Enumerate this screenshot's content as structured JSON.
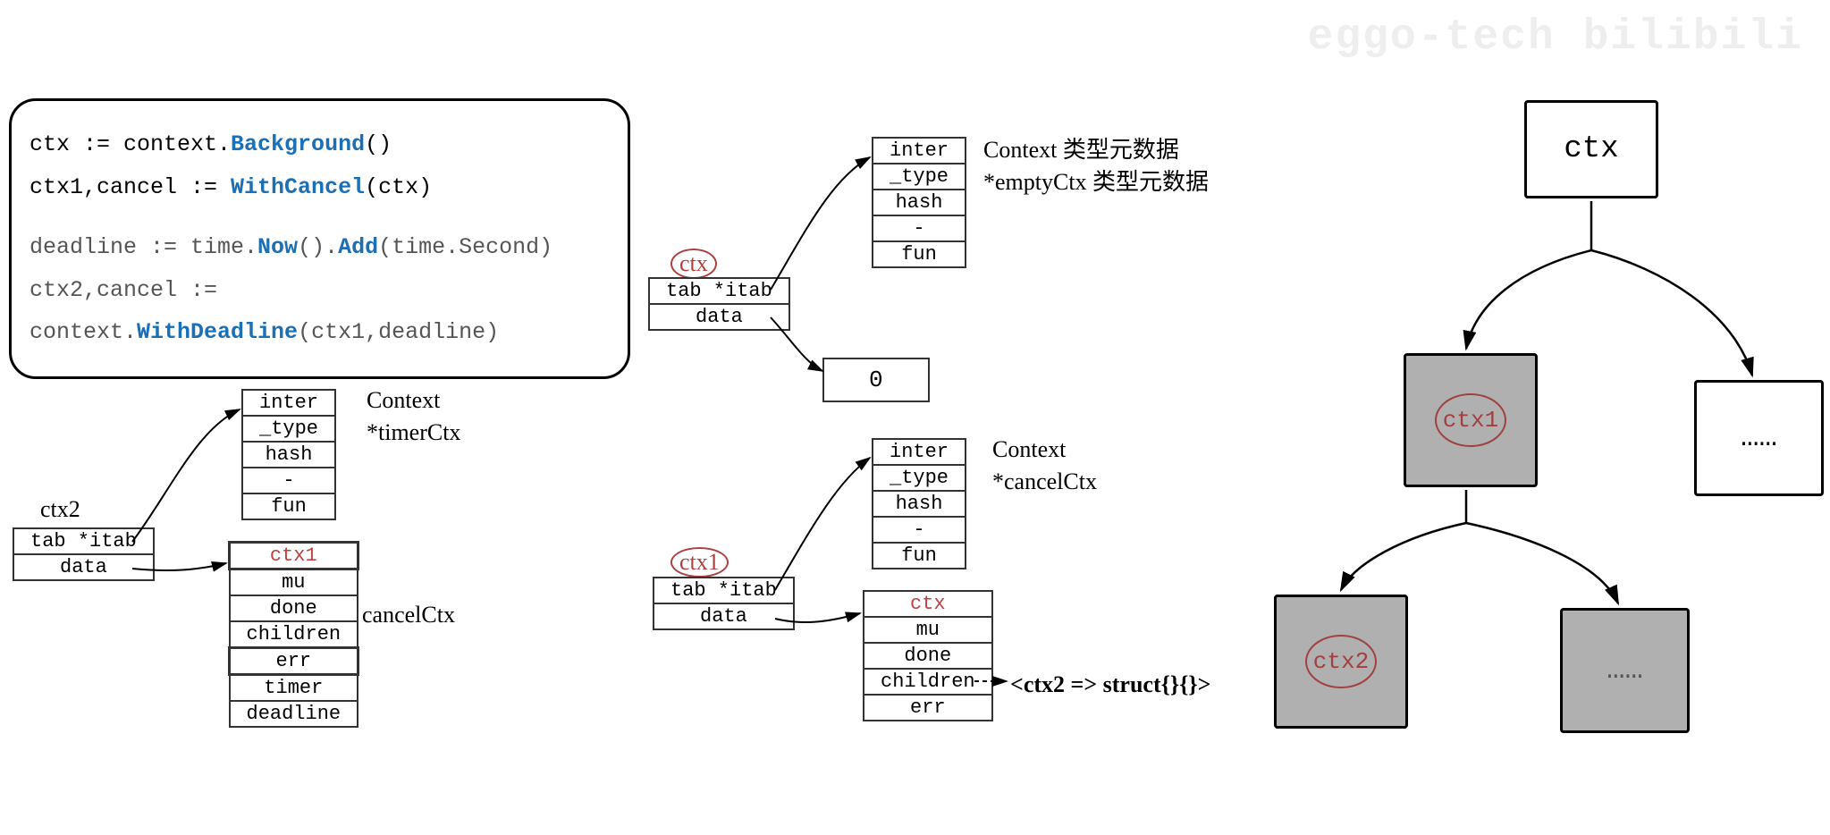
{
  "watermark": "eggo-tech bilibili",
  "code": {
    "line1a": "ctx := context.",
    "line1b": "Background",
    "line1c": "()",
    "line2a": "ctx1,cancel := ",
    "line2b": "WithCancel",
    "line2c": "(ctx)",
    "line3a": "deadline := time.",
    "line3b": "Now",
    "line3c": "().",
    "line3d": "Add",
    "line3e": "(time.Second)",
    "line4a": "ctx2,cancel := context.",
    "line4b": "WithDeadline",
    "line4c": "(ctx1,deadline)"
  },
  "itab_fields": {
    "r0": "inter",
    "r1": "_type",
    "r2": "hash",
    "r3": "-",
    "r4": "fun"
  },
  "iface_fields": {
    "r0": "tab *itab",
    "r1": "data"
  },
  "cancelctx_fields": {
    "title": "ctx1",
    "r0": "mu",
    "r1": "done",
    "r2": "children",
    "r3": "err"
  },
  "cancelctx_fields2": {
    "title": "ctx",
    "r0": "mu",
    "r1": "done",
    "r2": "children",
    "r3": "err"
  },
  "timerctx_extra": {
    "r0": "timer",
    "r1": "deadline"
  },
  "labels": {
    "ctx2_iface": "ctx2",
    "ctx_iface": "ctx",
    "ctx1_iface": "ctx1",
    "left_itab_side": {
      "l1": "Context",
      "l2": "*timerCtx"
    },
    "mid1_itab_side": {
      "l1": "Context 类型元数据",
      "l2": "*emptyCtx 类型元数据"
    },
    "mid2_itab_side": {
      "l1": "Context",
      "l2": "*cancelCtx"
    },
    "cancelctx_label": "cancelCtx",
    "children_map": "<ctx2 => struct{}{}>",
    "zero": "0"
  },
  "tree": {
    "root": "ctx",
    "l1a": "ctx1",
    "l1b": "……",
    "l2a": "ctx2",
    "l2b": "……"
  }
}
